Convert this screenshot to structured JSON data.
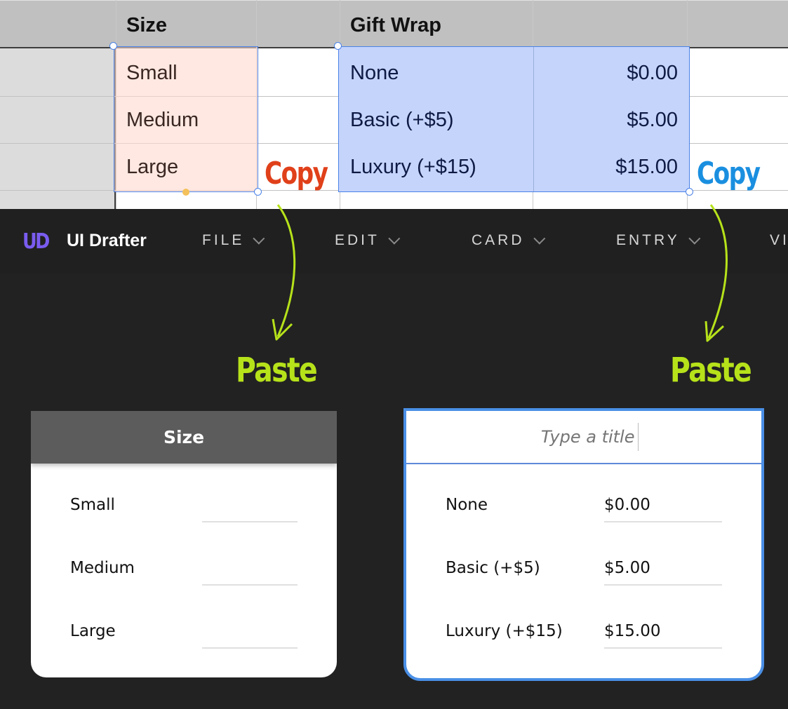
{
  "spreadsheet": {
    "headers": {
      "size": "Size",
      "gift_wrap": "Gift Wrap"
    },
    "size_rows": [
      "Small",
      "Medium",
      "Large"
    ],
    "gift_rows": [
      {
        "name": "None",
        "price": "$0.00"
      },
      {
        "name": "Basic (+$5)",
        "price": "$5.00"
      },
      {
        "name": "Luxury (+$15)",
        "price": "$15.00"
      }
    ],
    "selection_colors": {
      "size": "#fde0d6",
      "gift": "#c5d4fb",
      "border": "#4a82e8"
    }
  },
  "annotations": {
    "copy_left": "Copy",
    "copy_right": "Copy",
    "paste_left": "Paste",
    "paste_right": "Paste",
    "colors": {
      "copy_left": "#e0401a",
      "copy_right": "#1a8fe0",
      "paste": "#b6e21a",
      "arrow": "#b6e21a"
    }
  },
  "app": {
    "logo": "UD",
    "name": "UI Drafter",
    "menu": [
      {
        "label": "FILE"
      },
      {
        "label": "EDIT"
      },
      {
        "label": "CARD"
      },
      {
        "label": "ENTRY"
      },
      {
        "label": "VI"
      }
    ],
    "colors": {
      "menubar": "#202020",
      "logo": "#7a5cf0",
      "accent": "#4a8fe6"
    }
  },
  "cards": {
    "size": {
      "title": "Size",
      "rows": [
        {
          "label": "Small",
          "value": ""
        },
        {
          "label": "Medium",
          "value": ""
        },
        {
          "label": "Large",
          "value": ""
        }
      ]
    },
    "gift": {
      "title_placeholder": "Type a title",
      "title_value": "",
      "rows": [
        {
          "label": "None",
          "value": "$0.00"
        },
        {
          "label": "Basic (+$5)",
          "value": "$5.00"
        },
        {
          "label": "Luxury (+$15)",
          "value": "$15.00"
        }
      ]
    }
  }
}
